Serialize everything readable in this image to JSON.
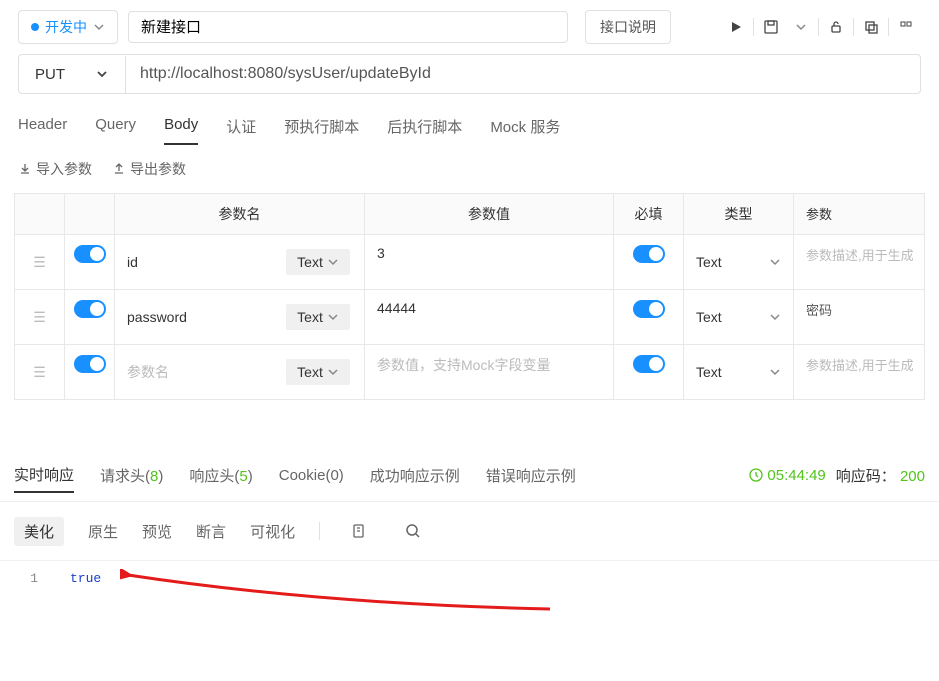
{
  "header": {
    "status_label": "开发中",
    "title": "新建接口",
    "api_desc_btn": "接口说明"
  },
  "request": {
    "method": "PUT",
    "url": "http://localhost:8080/sysUser/updateById"
  },
  "tabs": {
    "header": "Header",
    "query": "Query",
    "body": "Body",
    "auth": "认证",
    "pre_script": "预执行脚本",
    "post_script": "后执行脚本",
    "mock": "Mock 服务"
  },
  "param_buttons": {
    "import": "导入参数",
    "export": "导出参数"
  },
  "table_headers": {
    "name": "参数名",
    "value": "参数值",
    "required": "必填",
    "type": "类型",
    "desc": "参数"
  },
  "rows": [
    {
      "name": "id",
      "type_sel": "Text",
      "value": "3",
      "type": "Text",
      "desc": "参数描述,用于生成"
    },
    {
      "name": "password",
      "type_sel": "Text",
      "value": "44444",
      "type": "Text",
      "desc": "密码"
    },
    {
      "name": "",
      "name_ph": "参数名",
      "type_sel": "Text",
      "value": "",
      "value_ph": "参数值，支持Mock字段变量",
      "type": "Text",
      "desc": "参数描述,用于生成"
    }
  ],
  "response": {
    "tabs": {
      "realtime": "实时响应",
      "req_headers": "请求头",
      "req_headers_count": "8",
      "resp_headers": "响应头",
      "resp_headers_count": "5",
      "cookie": "Cookie",
      "cookie_count": "0",
      "success_example": "成功响应示例",
      "error_example": "错误响应示例"
    },
    "time": "05:44:49",
    "status_label": "响应码：",
    "status_code": "200",
    "subtabs": {
      "beautify": "美化",
      "raw": "原生",
      "preview": "预览",
      "assert": "断言",
      "visualize": "可视化"
    },
    "body_line": "1",
    "body_text": "true"
  }
}
